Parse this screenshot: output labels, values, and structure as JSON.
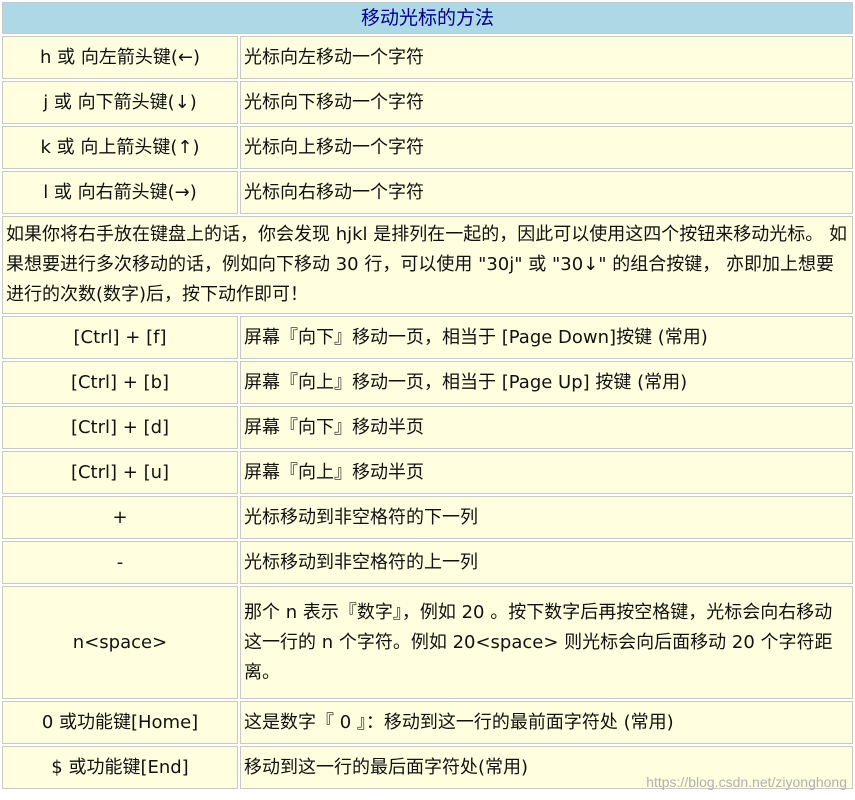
{
  "title": "移动光标的方法",
  "rows_top": [
    {
      "key": "h 或 向左箭头键(←)",
      "desc": "光标向左移动一个字符"
    },
    {
      "key": "j 或 向下箭头键(↓)",
      "desc": "光标向下移动一个字符"
    },
    {
      "key": "k 或 向上箭头键(↑)",
      "desc": "光标向上移动一个字符"
    },
    {
      "key": "l 或 向右箭头键(→)",
      "desc": "光标向右移动一个字符"
    }
  ],
  "note": "如果你将右手放在键盘上的话，你会发现 hjkl 是排列在一起的，因此可以使用这四个按钮来移动光标。 如果想要进行多次移动的话，例如向下移动 30 行，可以使用 \"30j\" 或 \"30↓\" 的组合按键， 亦即加上想要进行的次数(数字)后，按下动作即可！",
  "rows_bottom": [
    {
      "key": "[Ctrl] + [f]",
      "desc": "屏幕『向下』移动一页，相当于 [Page Down]按键 (常用)"
    },
    {
      "key": "[Ctrl] + [b]",
      "desc": "屏幕『向上』移动一页，相当于 [Page Up] 按键 (常用)"
    },
    {
      "key": "[Ctrl] + [d]",
      "desc": "屏幕『向下』移动半页"
    },
    {
      "key": "[Ctrl] + [u]",
      "desc": "屏幕『向上』移动半页"
    },
    {
      "key": "+",
      "desc": "光标移动到非空格符的下一列"
    },
    {
      "key": "-",
      "desc": "光标移动到非空格符的上一列"
    },
    {
      "key": "n<space>",
      "desc": "那个 n 表示『数字』，例如 20 。按下数字后再按空格键，光标会向右移动这一行的 n 个字符。例如 20<space> 则光标会向后面移动 20 个字符距离。"
    },
    {
      "key": "0 或功能键[Home]",
      "desc": "这是数字『 0 』：移动到这一行的最前面字符处 (常用)"
    },
    {
      "key": "$ 或功能键[End]",
      "desc": "移动到这一行的最后面字符处(常用)"
    }
  ],
  "watermark": "https://blog.csdn.net/ziyonghong",
  "colors": {
    "title_bg": "#add8e6",
    "title_text": "#00008b",
    "cell_bg": "#ffffe0"
  }
}
